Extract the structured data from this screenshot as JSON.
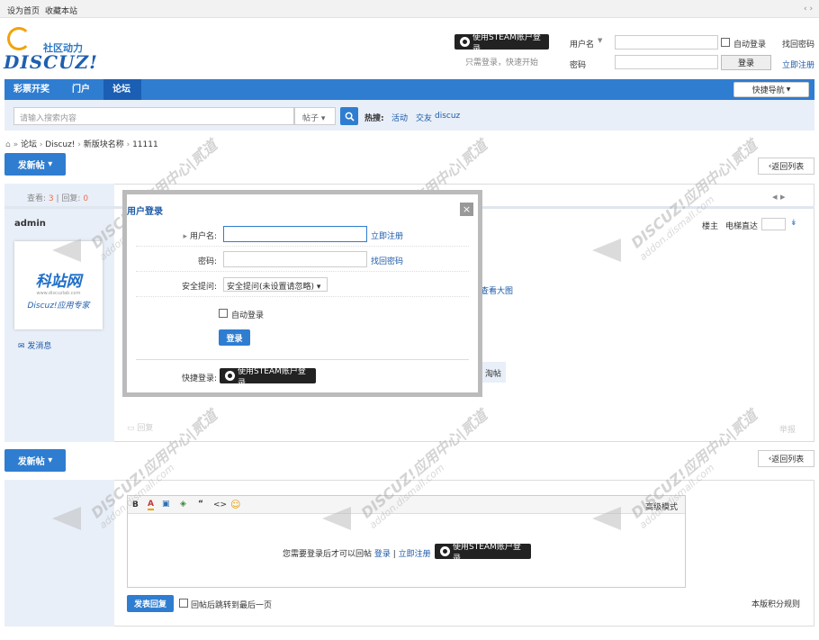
{
  "topbar": {
    "set_home": "设为首页",
    "favorite": "收藏本站",
    "scroll_arrows": "‹ ›"
  },
  "logo": {
    "sub": "社区动力",
    "main": "DISCUZ!"
  },
  "header": {
    "steam_label": "使用STEAM账户登录",
    "steam_sub": "只需登录，快速开始",
    "username_label": "用户名",
    "password_label": "密码",
    "auto_login": "自动登录",
    "find_password": "找回密码",
    "login_button": "登录",
    "register": "立即注册"
  },
  "nav": {
    "items": [
      "彩票开奖",
      "门户",
      "论坛"
    ],
    "quick_nav": "快捷导航"
  },
  "search": {
    "placeholder": "请输入搜索内容",
    "scope": "帖子",
    "hot_label": "热搜:",
    "hot_items": [
      "活动",
      "交友",
      "discuz"
    ]
  },
  "breadcrumb": [
    "论坛",
    "Discuz!",
    "新版块名称",
    "11111"
  ],
  "post_button": "发新帖",
  "back_list": "返回列表",
  "thread": {
    "views_label": "查看:",
    "views": "3",
    "replies_label": "回复:",
    "replies": "0",
    "author": "admin",
    "send_message": "发消息",
    "floor_host": "楼主",
    "elevator": "电梯直达",
    "view_large": "查看大图",
    "reply_partial": "淘帖",
    "reply_footer": "回复",
    "report": "举报"
  },
  "avatar_logo": {
    "title": "科站网",
    "url": "www.discuzlab.com",
    "caption": "Discuz!应用专家"
  },
  "modal": {
    "title": "用户登录",
    "username_label": "用户名:",
    "register_link": "立即注册",
    "password_label": "密码:",
    "find_password": "找回密码",
    "security_label": "安全提问:",
    "security_selected": "安全提问(未设置请忽略)",
    "auto_login": "自动登录",
    "login_button": "登录",
    "quick_login_label": "快捷登录:",
    "steam_label": "使用STEAM账户登录"
  },
  "editor": {
    "toolbar": [
      "B",
      "A",
      "▣",
      "◈",
      "“",
      "<>",
      "☺"
    ],
    "advanced": "高级模式",
    "notice": "您需要登录后才可以回帖",
    "login_link": "登录",
    "register_link": "立即注册",
    "steam_label": "使用STEAM账户登录",
    "submit": "发表回复",
    "jump_last": "回帖后跳转到最后一页",
    "rules": "本版积分规则"
  },
  "watermark": {
    "brand": "DISCUZ!应用中心",
    "domain": "addon.dismall.com",
    "mark": "|贰道"
  }
}
